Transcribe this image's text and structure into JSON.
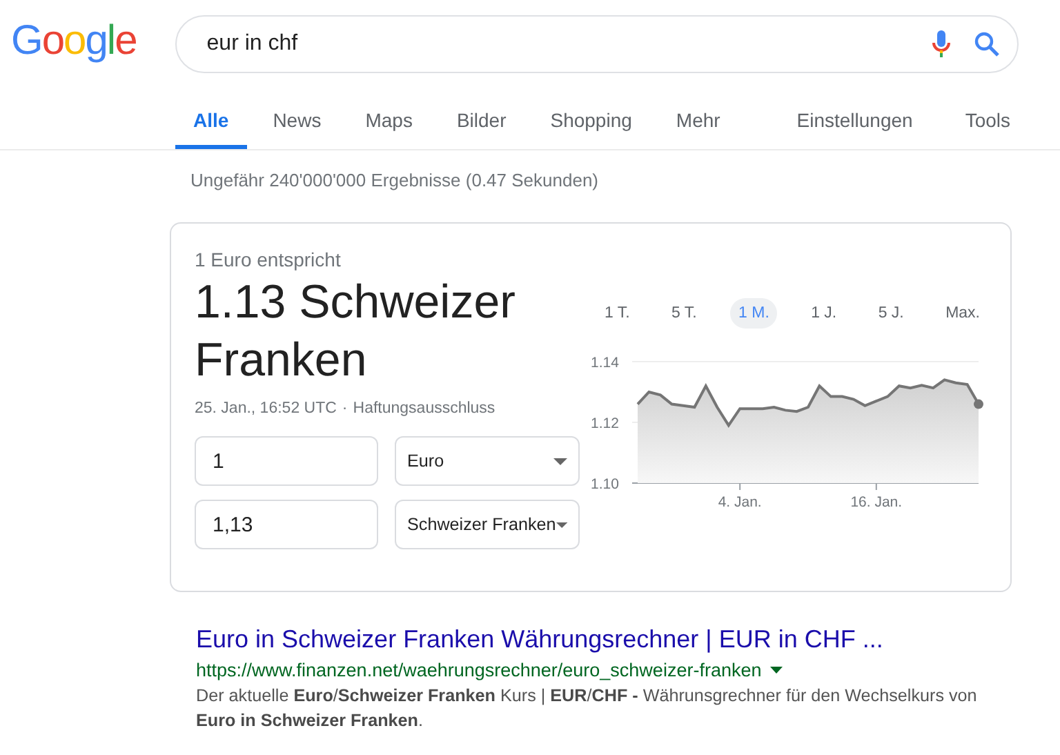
{
  "logo": "Google",
  "search": {
    "value": "eur in chf"
  },
  "tabs": [
    {
      "label": "Alle",
      "selected": true
    },
    {
      "label": "News",
      "selected": false
    },
    {
      "label": "Maps",
      "selected": false
    },
    {
      "label": "Bilder",
      "selected": false
    },
    {
      "label": "Shopping",
      "selected": false
    },
    {
      "label": "Mehr",
      "selected": false
    }
  ],
  "tools": [
    "Einstellungen",
    "Tools"
  ],
  "result_stats": "Ungefähr 240'000'000 Ergebnisse (0.47 Sekunden)",
  "converter": {
    "heading": "1 Euro entspricht",
    "result": "1.13 Schweizer Franken",
    "timestamp": "25. Jan., 16:52 UTC",
    "separator": "·",
    "disclaimer": "Haftungsausschluss",
    "rows": [
      {
        "amount": "1",
        "currency": "Euro"
      },
      {
        "amount": "1,13",
        "currency": "Schweizer Franken"
      }
    ],
    "ranges": [
      {
        "label": "1 T.",
        "selected": false
      },
      {
        "label": "5 T.",
        "selected": false
      },
      {
        "label": "1 M.",
        "selected": true
      },
      {
        "label": "1 J.",
        "selected": false
      },
      {
        "label": "5 J.",
        "selected": false
      },
      {
        "label": "Max.",
        "selected": false
      }
    ],
    "chart_data": {
      "type": "area",
      "categories": [
        null,
        null,
        null,
        null,
        null,
        null,
        null,
        null,
        null,
        "4. Jan.",
        null,
        null,
        null,
        null,
        null,
        null,
        null,
        null,
        null,
        null,
        null,
        "16. Jan.",
        null,
        null,
        null,
        null,
        null,
        null,
        null,
        null,
        null
      ],
      "series": [
        {
          "color": "#757575",
          "values": [
            1.126,
            1.13,
            1.129,
            1.126,
            1.1255,
            1.125,
            1.132,
            1.125,
            1.119,
            1.1245,
            1.1245,
            1.1245,
            1.125,
            1.124,
            1.1236,
            1.125,
            1.132,
            1.1285,
            1.1285,
            1.1276,
            1.1255,
            1.127,
            1.1285,
            1.132,
            1.1313,
            1.1322,
            1.1313,
            1.134,
            1.133,
            1.1325,
            1.126
          ]
        }
      ],
      "ylim": [
        1.1,
        1.14
      ],
      "yticks": [
        {
          "value": 1.1,
          "label": "1.10"
        },
        {
          "value": 1.12,
          "label": "1.12"
        },
        {
          "value": 1.14,
          "label": "1.14"
        }
      ]
    }
  },
  "result": {
    "title": "Euro in Schweizer Franken Währungsrechner | EUR in CHF ...",
    "url": "https://www.finanzen.net/waehrungsrechner/euro_schweizer-franken",
    "snippet": "Der aktuelle **Euro**/**Schweizer Franken** Kurs | **EUR**/**CHF** **-** Währunsgrechner für den Wechselkurs von **Euro in Schweizer Franken**."
  }
}
